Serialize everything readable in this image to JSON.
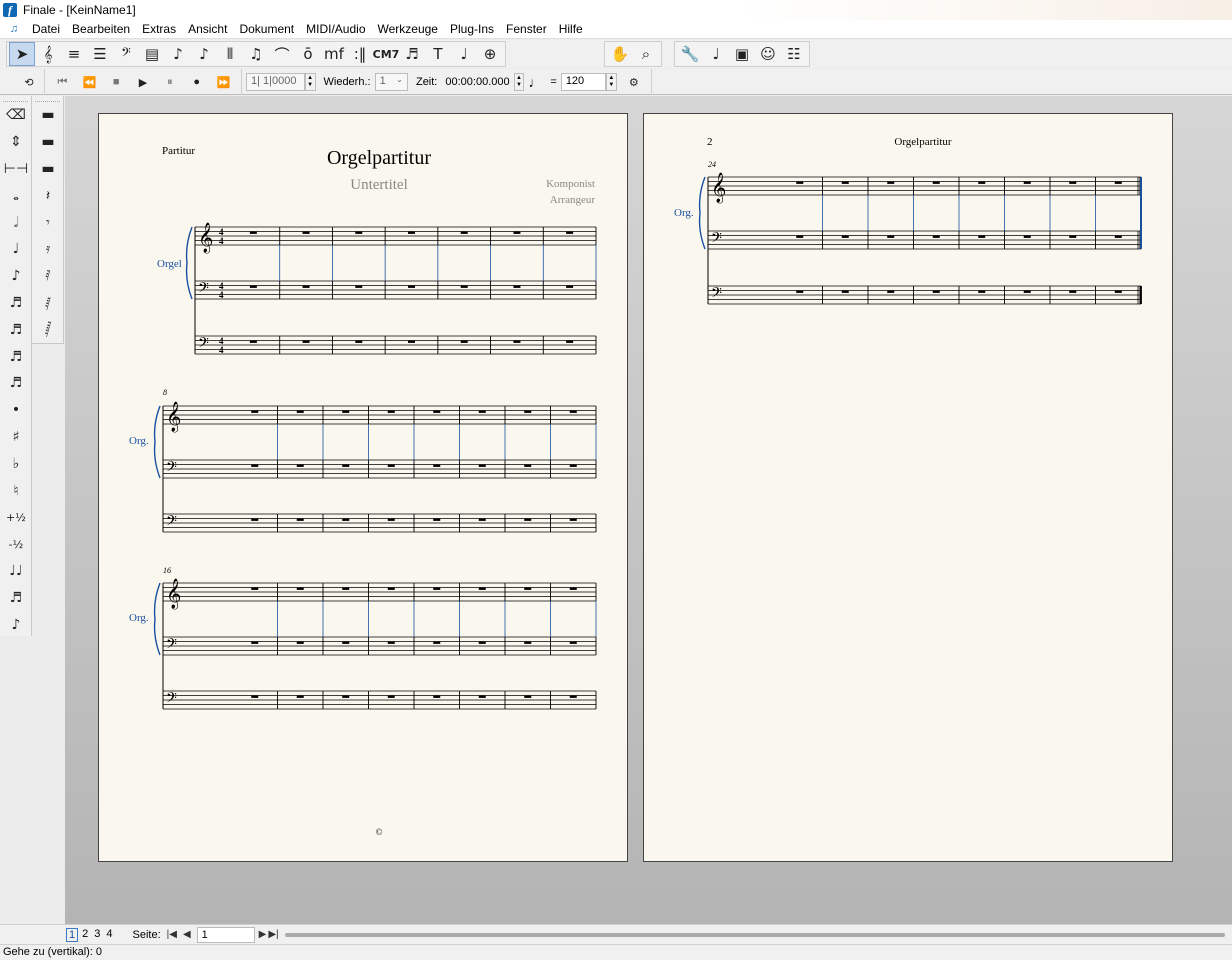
{
  "window": {
    "title": "Finale  - [KeinName1]",
    "app_glyph": "f"
  },
  "menu": [
    "Datei",
    "Bearbeiten",
    "Extras",
    "Ansicht",
    "Dokument",
    "MIDI/Audio",
    "Werkzeuge",
    "Plug-Ins",
    "Fenster",
    "Hilfe"
  ],
  "toolbar": {
    "groups": [
      [
        {
          "name": "selection-tool-icon",
          "glyph": "➤",
          "active": true
        },
        {
          "name": "staff-tool-icon",
          "glyph": "𝄞"
        },
        {
          "name": "key-signature-tool-icon",
          "glyph": "≡"
        },
        {
          "name": "time-signature-tool-icon",
          "glyph": "☰"
        },
        {
          "name": "clef-tool-icon",
          "glyph": "𝄢"
        },
        {
          "name": "measure-tool-icon",
          "glyph": "▤"
        },
        {
          "name": "simple-entry-tool-icon",
          "glyph": "♪"
        },
        {
          "name": "speedy-entry-tool-icon",
          "glyph": "♪"
        },
        {
          "name": "tuplet-tool-icon",
          "glyph": "⫴"
        },
        {
          "name": "smart-shape-tool-icon",
          "glyph": "♫"
        },
        {
          "name": "slur-tool-icon",
          "glyph": "⌒"
        },
        {
          "name": "articulation-tool-icon",
          "glyph": "ō"
        },
        {
          "name": "expression-tool-icon",
          "glyph": "mf"
        },
        {
          "name": "repeat-tool-icon",
          "glyph": ":‖"
        },
        {
          "name": "chord-tool-icon",
          "glyph": "CM7",
          "small": true
        },
        {
          "name": "lyrics-tool-icon",
          "glyph": "♬"
        },
        {
          "name": "text-tool-icon",
          "glyph": "T"
        },
        {
          "name": "mirror-tool-icon",
          "glyph": "♩"
        },
        {
          "name": "special-tools-icon",
          "glyph": "⊕"
        }
      ],
      [
        {
          "name": "hand-grabber-tool-icon",
          "glyph": "✋"
        },
        {
          "name": "zoom-tool-icon",
          "glyph": "⌕"
        }
      ],
      [
        {
          "name": "wrench-utility-icon",
          "glyph": "🔧"
        },
        {
          "name": "note-mover-tool-icon",
          "glyph": "♩"
        },
        {
          "name": "graphics-tool-icon",
          "glyph": "▣"
        },
        {
          "name": "midi-tool-icon",
          "glyph": "☺"
        },
        {
          "name": "score-manager-icon",
          "glyph": "☷"
        }
      ]
    ]
  },
  "playback": {
    "counter": "1| 1|0000",
    "repeat_label": "Wiederh.:",
    "repeat_value": "1",
    "time_label": "Zeit:",
    "time_value": "00:00:00.000",
    "equals": "=",
    "tempo": "120"
  },
  "palette_a": [
    "⌫",
    "⇕",
    "⊢⊣",
    "𝅝",
    "𝅗𝅥",
    "♩",
    "♪",
    "♬",
    "♬",
    "♬",
    "♬",
    "•",
    "♯",
    "♭",
    "♮",
    "+½",
    "-½",
    "♩♩",
    "♬",
    "♪"
  ],
  "palette_b": [
    "▬",
    "▬",
    "▬",
    "𝄽",
    "𝄾",
    "𝄿",
    "𝅀",
    "𝅁",
    "𝅂"
  ],
  "page1": {
    "header_left": "Partitur",
    "title": "Orgelpartitur",
    "subtitle": "Untertitel",
    "composer": "Komponist",
    "arranger": "Arrangeur",
    "inst_full": "Orgel",
    "inst_short": "Org.",
    "system_numbers": [
      "8",
      "16"
    ],
    "copyright": "©"
  },
  "page2": {
    "page_number": "2",
    "running_title": "Orgelpartitur",
    "inst_short": "Org.",
    "system_number": "24"
  },
  "pagenav": {
    "pages": [
      "1",
      "2",
      "3",
      "4"
    ],
    "current": "1",
    "label": "Seite:",
    "value": "1"
  },
  "status": "Gehe zu (vertikal): 0"
}
